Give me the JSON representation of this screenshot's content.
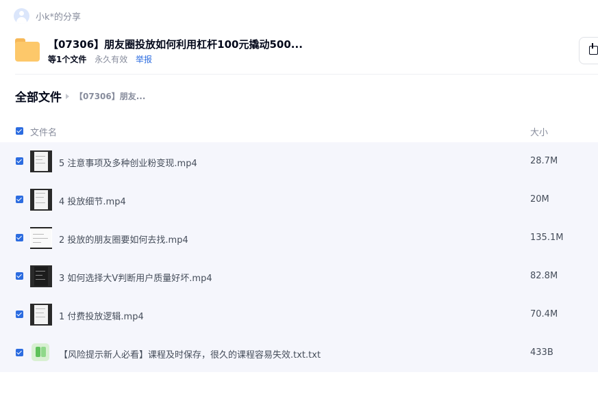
{
  "user": {
    "name": "小k*的分享"
  },
  "share": {
    "title": "【07306】朋友圈投放如何利用杠杆100元撬动500...",
    "file_count": "等1个文件",
    "validity": "永久有效",
    "report_label": "举报"
  },
  "breadcrumb": {
    "root": "全部文件",
    "current": "【07306】朋友..."
  },
  "table": {
    "header_name": "文件名",
    "header_size": "大小",
    "rows": [
      {
        "name": "5 注意事项及多种创业粉变现.mp4",
        "size": "28.7M",
        "kind": "video"
      },
      {
        "name": "4 投放细节.mp4",
        "size": "20M",
        "kind": "video"
      },
      {
        "name": "2 投放的朋友圈要如何去找.mp4",
        "size": "135.1M",
        "kind": "video"
      },
      {
        "name": "3 如何选择大V判断用户质量好坏.mp4",
        "size": "82.8M",
        "kind": "video"
      },
      {
        "name": "1 付费投放逻辑.mp4",
        "size": "70.4M",
        "kind": "video"
      },
      {
        "name": "【风险提示新人必看】课程及时保存，很久的课程容易失效.txt.txt",
        "size": "433B",
        "kind": "txt"
      }
    ]
  },
  "colors": {
    "accent": "#2c6ce0",
    "row_background": "#f5f6fc",
    "folder": "#fdc86a"
  }
}
